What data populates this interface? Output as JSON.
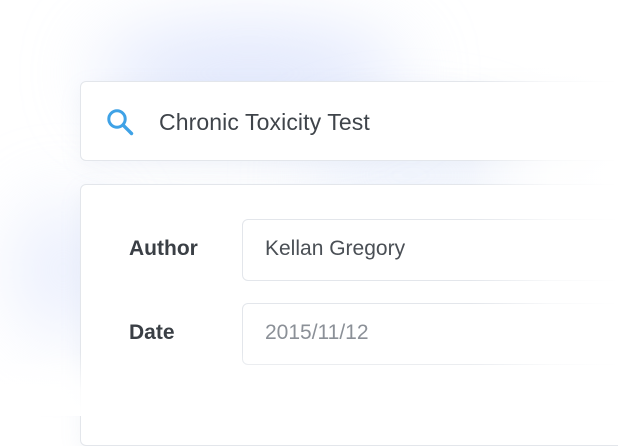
{
  "search": {
    "query": "Chronic Toxicity Test",
    "icon": "search-icon",
    "icon_color": "#3fa2e6"
  },
  "form": {
    "fields": [
      {
        "label": "Author",
        "value": "Kellan Gregory",
        "value_color": "#4a4f55"
      },
      {
        "label": "Date",
        "value": "2015/11/12",
        "value_color": "#8b9097"
      }
    ]
  }
}
